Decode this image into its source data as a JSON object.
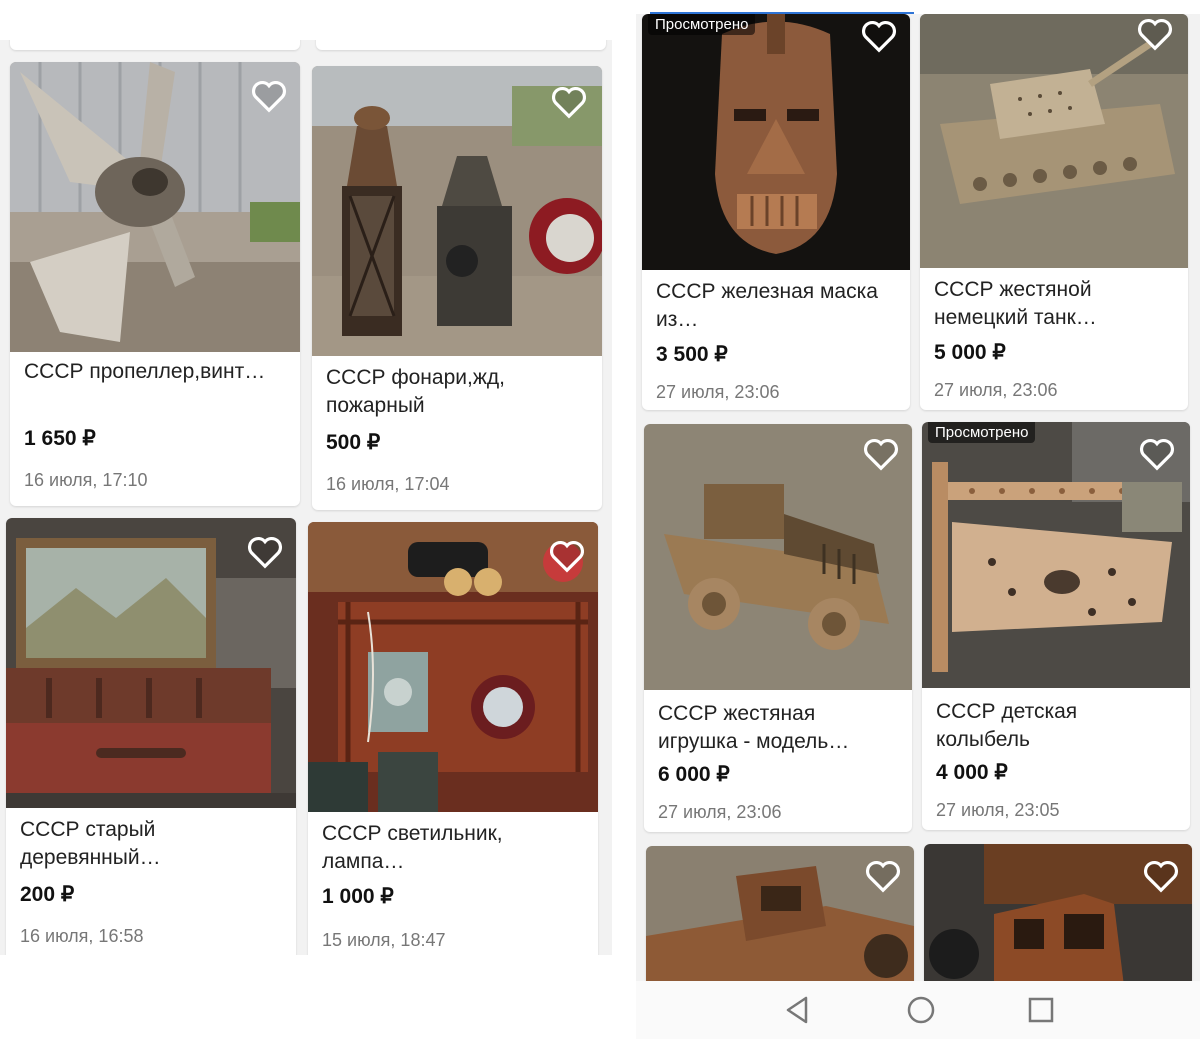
{
  "heart_icon": "heart-outline",
  "left_column": [
    {
      "title": "СССР пропеллер,винт…",
      "price": "1 650 ₽",
      "date": "16 июля, 17:10"
    },
    {
      "title": "СССР фонари,жд, пожарный",
      "price": "500 ₽",
      "date": "16 июля, 17:04"
    },
    {
      "title": "СССР старый деревянный…",
      "price": "200 ₽",
      "date": "16 июля, 16:58"
    },
    {
      "title": "СССР светильник, лампа…",
      "price": "1 000 ₽",
      "date": "15 июля, 18:47"
    }
  ],
  "right_column": [
    {
      "badge": "Просмотрено",
      "title": "СССР железная маска из…",
      "price": "3 500 ₽",
      "date": "27 июля, 23:06"
    },
    {
      "title": "СССР жестяной немецкий танк…",
      "price": "5 000 ₽",
      "date": "27 июля, 23:06"
    },
    {
      "title": "СССР жестяная игрушка - модель…",
      "price": "6 000 ₽",
      "date": "27 июля, 23:06"
    },
    {
      "badge": "Просмотрено",
      "title": "СССР детская колыбель",
      "price": "4 000 ₽",
      "date": "27 июля, 23:05"
    }
  ],
  "navigation": {
    "back": "triangle-back-icon",
    "home": "circle-home-icon",
    "recents": "square-recents-icon"
  },
  "colors": {
    "accent": "#2e74d6",
    "price": "#111111",
    "date": "#777777",
    "background": "#f2f2f2"
  }
}
